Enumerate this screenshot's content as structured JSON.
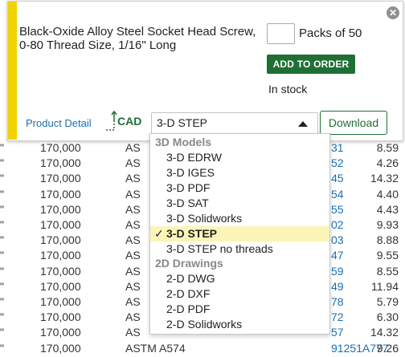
{
  "panel": {
    "product_description": "Black-Oxide Alloy Steel Socket Head Screw, 0-80 Thread Size, 1/16\" Long",
    "quantity_value": "",
    "packs_label": "Packs of 50",
    "add_to_order_label": "ADD TO ORDER",
    "stock_status": "In stock",
    "product_detail_link": "Product Detail",
    "cad_label": "CAD",
    "cad_format_selected": "3-D STEP",
    "download_label": "Download",
    "close_icon": "close-icon",
    "accent_color": "#f2d300",
    "button_color": "#1f6f34"
  },
  "dropdown": {
    "groups": [
      {
        "label": "3D Models",
        "items": [
          "3-D EDRW",
          "3-D IGES",
          "3-D PDF",
          "3-D SAT",
          "3-D Solidworks",
          "3-D STEP",
          "3-D STEP no threads"
        ]
      },
      {
        "label": "2D Drawings",
        "items": [
          "2-D DWG",
          "2-D DXF",
          "2-D PDF",
          "2-D Solidworks"
        ]
      }
    ],
    "selected": "3-D STEP",
    "check_mark": "✓"
  },
  "background_table": {
    "rows": [
      {
        "q": "\"",
        "strength": "170,000",
        "spec": "AS",
        "part": "31",
        "price": "8.59"
      },
      {
        "q": "\"",
        "strength": "170,000",
        "spec": "AS",
        "part": "52",
        "price": "4.26"
      },
      {
        "q": "\"",
        "strength": "170,000",
        "spec": "AS",
        "part": "45",
        "price": "14.32"
      },
      {
        "q": "\"",
        "strength": "170,000",
        "spec": "AS",
        "part": "54",
        "price": "4.40"
      },
      {
        "q": "\"",
        "strength": "170,000",
        "spec": "AS",
        "part": "55",
        "price": "4.43"
      },
      {
        "q": "\"",
        "strength": "170,000",
        "spec": "AS",
        "part": "02",
        "price": "9.93"
      },
      {
        "q": "\"",
        "strength": "170,000",
        "spec": "AS",
        "part": "03",
        "price": "8.88"
      },
      {
        "q": "\"",
        "strength": "170,000",
        "spec": "AS",
        "part": "47",
        "price": "9.55"
      },
      {
        "q": "\"",
        "strength": "170,000",
        "spec": "AS",
        "part": "59",
        "price": "8.55"
      },
      {
        "q": "\"",
        "strength": "170,000",
        "spec": "AS",
        "part": "49",
        "price": "11.94"
      },
      {
        "q": "\"",
        "strength": "170,000",
        "spec": "AS",
        "part": "78",
        "price": "5.79"
      },
      {
        "q": "\"",
        "strength": "170,000",
        "spec": "AS",
        "part": "72",
        "price": "6.30"
      },
      {
        "q": "\"",
        "strength": "170,000",
        "spec": "AS",
        "part": "57",
        "price": "14.32"
      },
      {
        "q": "\"",
        "strength": "170,000",
        "spec": "ASTM A574",
        "part": "91251A777",
        "price": "9.26"
      }
    ]
  }
}
